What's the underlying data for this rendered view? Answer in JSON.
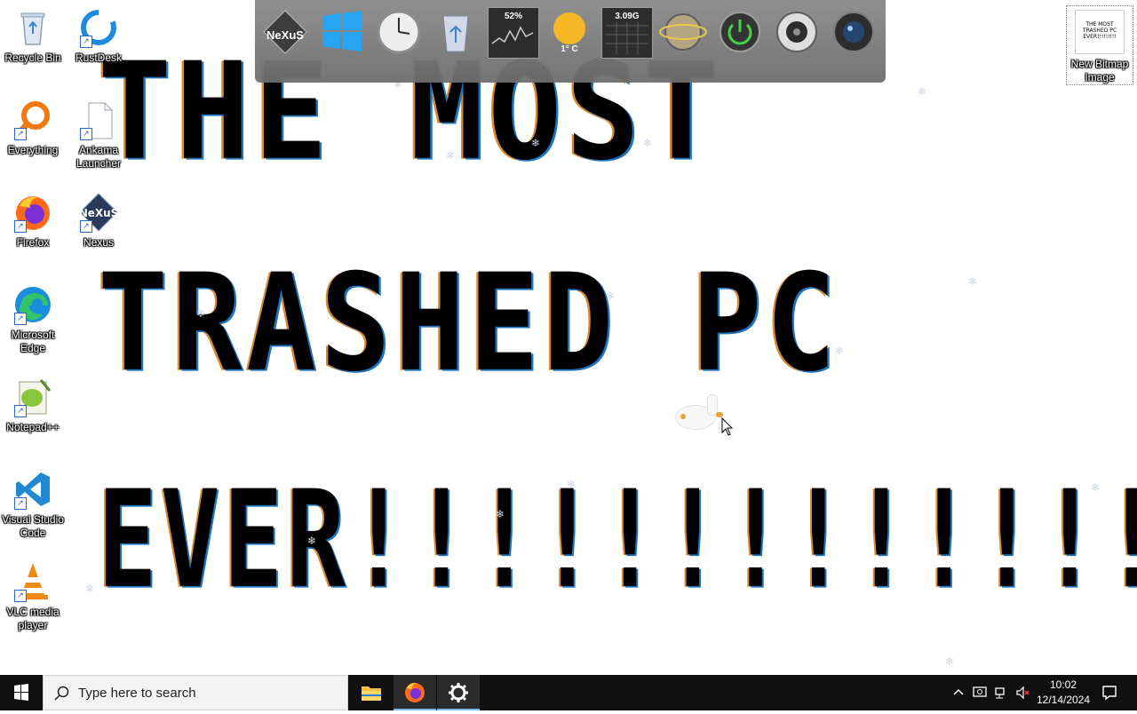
{
  "desktop": {
    "big_text": {
      "line1": "THE MOST",
      "line2": "TRASHED PC",
      "line3": "EVER!!!!!!!!!!!!!!!"
    },
    "icons": [
      {
        "label": "Recycle Bin"
      },
      {
        "label": "RustDesk"
      },
      {
        "label": "Everything"
      },
      {
        "label": "Ankama Launcher"
      },
      {
        "label": "Firefox"
      },
      {
        "label": "Nexus"
      },
      {
        "label": "Microsoft Edge"
      },
      {
        "label": "Notepad++"
      },
      {
        "label": "Visual Studio Code"
      },
      {
        "label": "VLC media player"
      },
      {
        "label": "New Bitmap Image"
      }
    ],
    "bitmap_thumb_text": "THE MOST TRASHED PC EVER!!!!!!!!!"
  },
  "dock": {
    "logo": "NeXuS",
    "cpu_percent": "52%",
    "temperature": "1° C",
    "memory": "3.09G"
  },
  "taskbar": {
    "search_placeholder": "Type here to search",
    "time": "10:02",
    "date": "12/14/2024"
  },
  "colors": {
    "accent": "#76b9ed",
    "taskbar_bg": "#101010",
    "pixel_blue": "#1e73be",
    "pixel_orange": "#d98a2a"
  }
}
